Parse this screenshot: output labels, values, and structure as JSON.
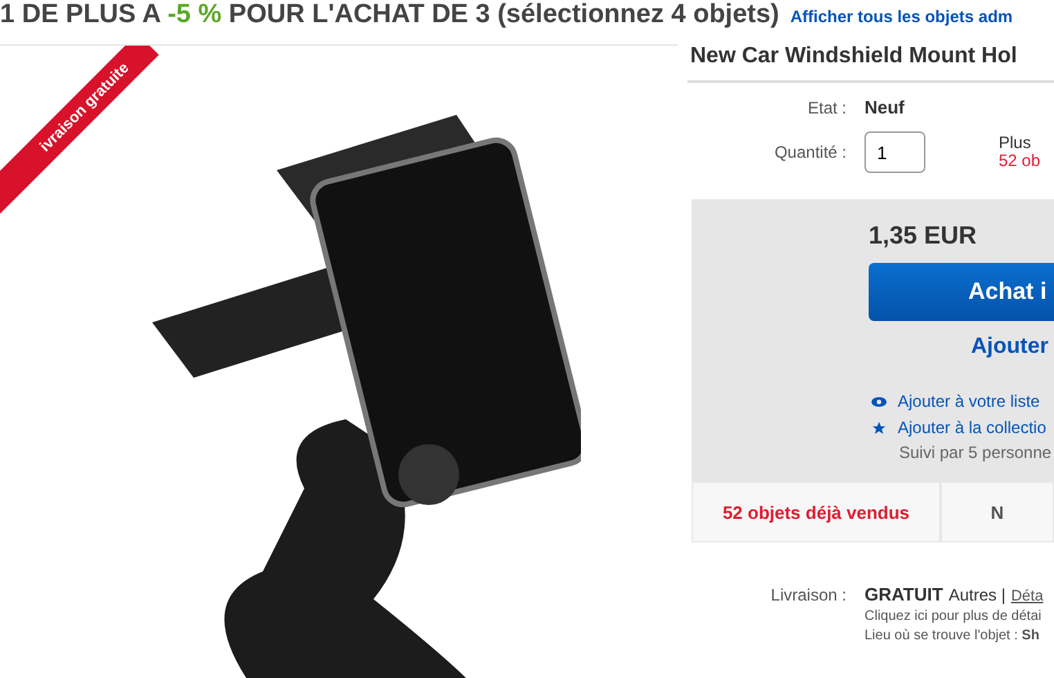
{
  "promo": {
    "prefix": "1 DE PLUS A",
    "discount": "-5 %",
    "suffix": "POUR L'ACHAT DE 3 (sélectionnez 4 objets)",
    "link": "Afficher tous les objets adm"
  },
  "product": {
    "ribbon": "ivraison gratuite",
    "title": "New Car Windshield Mount Hol"
  },
  "details": [
    {
      "label": "Etat :",
      "value": "Neuf"
    }
  ],
  "quantity": {
    "label": "Quantité :",
    "value": "1",
    "availability": "Plus",
    "sold_count": "52 ob"
  },
  "buy_box": {
    "price": "1,35 EUR",
    "buy_button": "Achat i",
    "cart_link": "Ajouter",
    "actions": [
      {
        "kind": "watch",
        "label": "Ajouter à votre liste"
      },
      {
        "kind": "collection",
        "label": "Ajouter à la collectio"
      }
    ],
    "followers": "Suivi par 5 personne"
  },
  "stats": [
    "52 objets déjà vendus",
    "N"
  ],
  "shipping": {
    "label": "Livraison :",
    "cost": "GRATUIT",
    "other": "Autres |",
    "details_link": "Déta",
    "note": "Cliquez ici pour plus de détai",
    "location_label": "Lieu où se trouve l'objet :",
    "location": "Sh"
  }
}
